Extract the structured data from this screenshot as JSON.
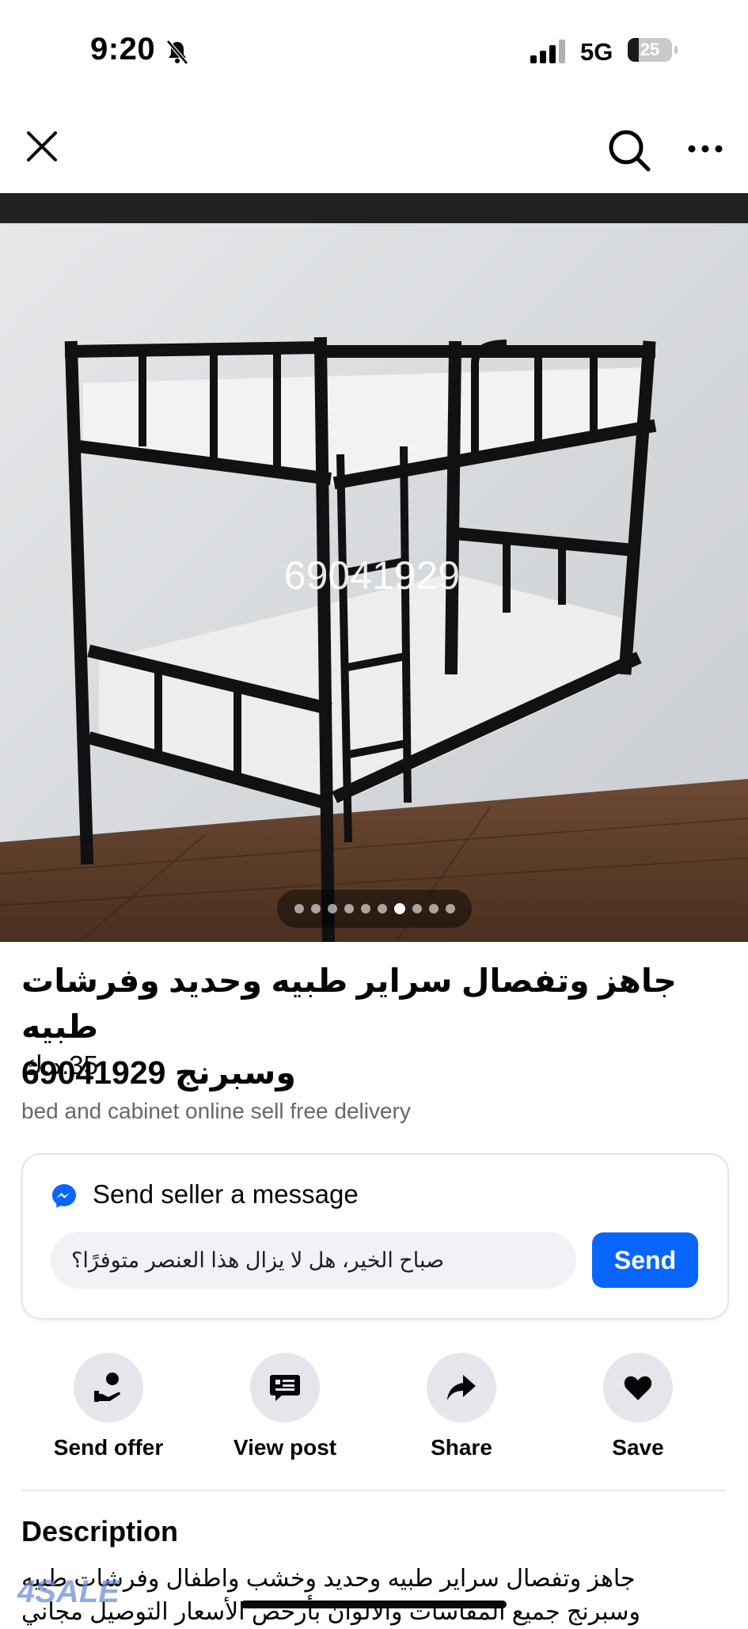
{
  "status_bar": {
    "time": "9:20",
    "network": "5G",
    "battery_level": "25",
    "battery_fraction": 0.25
  },
  "nav": {
    "close_icon": "close-icon",
    "search_icon": "search-icon",
    "more_icon": "more-icon"
  },
  "listing": {
    "photo_overlay_text": "69041929",
    "photo_count": 10,
    "active_photo_index": 6,
    "title_line1": "جاهز وتفصال سراير طبيه وحديد وفرشات طبيه",
    "title_line2": "وسبرنج 69041929",
    "price": "35.د.ك",
    "subtitle": "bed and cabinet online sell free delivery"
  },
  "message": {
    "heading": "Send seller a message",
    "input_value": "صباح الخير، هل لا يزال هذا العنصر متوفرًا؟",
    "send_label": "Send"
  },
  "actions": [
    {
      "label": "Send offer",
      "icon": "offer-icon"
    },
    {
      "label": "View post",
      "icon": "post-icon"
    },
    {
      "label": "Share",
      "icon": "share-icon"
    },
    {
      "label": "Save",
      "icon": "heart-icon"
    }
  ],
  "description": {
    "heading": "Description",
    "line1": "جاهز وتفصال سراير طبيه وحديد وخشب واطفال وفرشات طبيه",
    "line2": "وسبرنج جميع المقاسات والالوان بأرخص الأسعار التوصيل مجاني"
  },
  "watermark": "4SALE",
  "colors": {
    "accent": "#0866ff",
    "secondary_text": "#65676b",
    "button_bg": "#e4e6eb",
    "input_bg": "#f0f2f5"
  }
}
